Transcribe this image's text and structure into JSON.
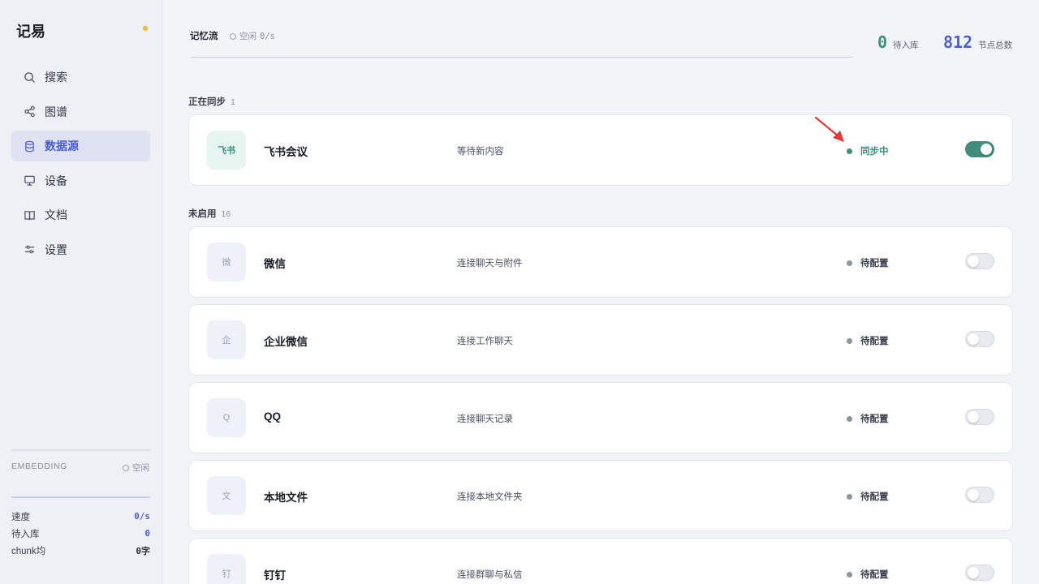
{
  "app": {
    "name": "记易"
  },
  "sidebar": {
    "items": [
      {
        "label": "搜索",
        "icon": "search-icon"
      },
      {
        "label": "图谱",
        "icon": "share-graph-icon"
      },
      {
        "label": "数据源",
        "icon": "database-icon",
        "active": true
      },
      {
        "label": "设备",
        "icon": "monitor-icon"
      },
      {
        "label": "文档",
        "icon": "book-icon"
      },
      {
        "label": "设置",
        "icon": "sliders-icon"
      }
    ],
    "embedding": {
      "label": "EMBEDDING",
      "status": "空闲"
    },
    "stats": [
      {
        "label": "速度",
        "value": "0/s"
      },
      {
        "label": "待入库",
        "value": "0"
      },
      {
        "label": "chunk均",
        "value": "0",
        "unit": "字"
      }
    ]
  },
  "header": {
    "title": "记忆流",
    "status_label": "空闲",
    "status_rate": "0/s",
    "kpis": {
      "queue": {
        "value": "0",
        "label": "待入库"
      },
      "nodes": {
        "value": "812",
        "label": "节点总数"
      }
    }
  },
  "sections": {
    "syncing": {
      "title": "正在同步",
      "count": "1"
    },
    "disabled": {
      "title": "未启用",
      "count": "16"
    }
  },
  "sources": [
    {
      "logo": "飞书",
      "name": "飞书会议",
      "desc": "等待新内容",
      "state": "同步中",
      "enabled": true
    },
    {
      "logo": "微",
      "name": "微信",
      "desc": "连接聊天与附件",
      "state": "待配置",
      "enabled": false
    },
    {
      "logo": "企",
      "name": "企业微信",
      "desc": "连接工作聊天",
      "state": "待配置",
      "enabled": false
    },
    {
      "logo": "Q",
      "name": "QQ",
      "desc": "连接聊天记录",
      "state": "待配置",
      "enabled": false
    },
    {
      "logo": "文",
      "name": "本地文件",
      "desc": "连接本地文件夹",
      "state": "待配置",
      "enabled": false
    },
    {
      "logo": "钉",
      "name": "钉钉",
      "desc": "连接群聊与私信",
      "state": "待配置",
      "enabled": false
    }
  ],
  "colors": {
    "accent": "#4a5fd1",
    "sync_green": "#3a8f7d",
    "annotation_red": "#e53935"
  }
}
